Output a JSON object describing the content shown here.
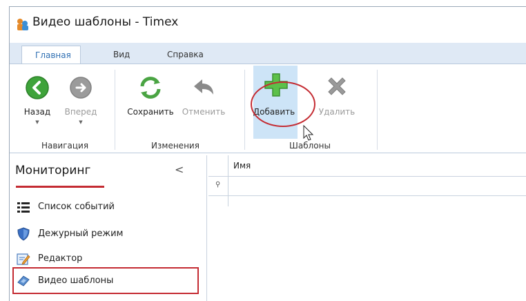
{
  "window": {
    "title": "Видео шаблоны - Timex"
  },
  "tabs": [
    {
      "label": "Главная",
      "active": true
    },
    {
      "label": "Вид",
      "active": false
    },
    {
      "label": "Справка",
      "active": false
    }
  ],
  "ribbon": {
    "groups": [
      {
        "label": "Навигация",
        "buttons": [
          {
            "label": "Назад",
            "icon": "back-arrow-icon",
            "enabled": true
          },
          {
            "label": "Вперед",
            "icon": "forward-arrow-icon",
            "enabled": false
          }
        ]
      },
      {
        "label": "Изменения",
        "buttons": [
          {
            "label": "Сохранить",
            "icon": "refresh-save-icon",
            "enabled": true
          },
          {
            "label": "Отменить",
            "icon": "undo-icon",
            "enabled": false
          }
        ]
      },
      {
        "label": "Шаблоны",
        "buttons": [
          {
            "label": "Добавить",
            "icon": "plus-icon",
            "enabled": true,
            "highlighted": true
          },
          {
            "label": "Удалить",
            "icon": "x-delete-icon",
            "enabled": false
          }
        ]
      }
    ]
  },
  "sidebar": {
    "title": "Мониторинг",
    "items": [
      {
        "label": "Список событий",
        "icon": "list-icon"
      },
      {
        "label": "Дежурный режим",
        "icon": "shield-icon"
      },
      {
        "label": "Редактор",
        "icon": "editor-icon"
      },
      {
        "label": "Видео шаблоны",
        "icon": "video-template-icon",
        "selected": true
      }
    ]
  },
  "grid": {
    "columns": [
      "Имя"
    ],
    "rows": []
  },
  "colors": {
    "accent": "#2f6fb3",
    "annotation_red": "#c42b32",
    "ribbon_bg": "#dfe9f5",
    "highlight": "#cde4f7"
  }
}
